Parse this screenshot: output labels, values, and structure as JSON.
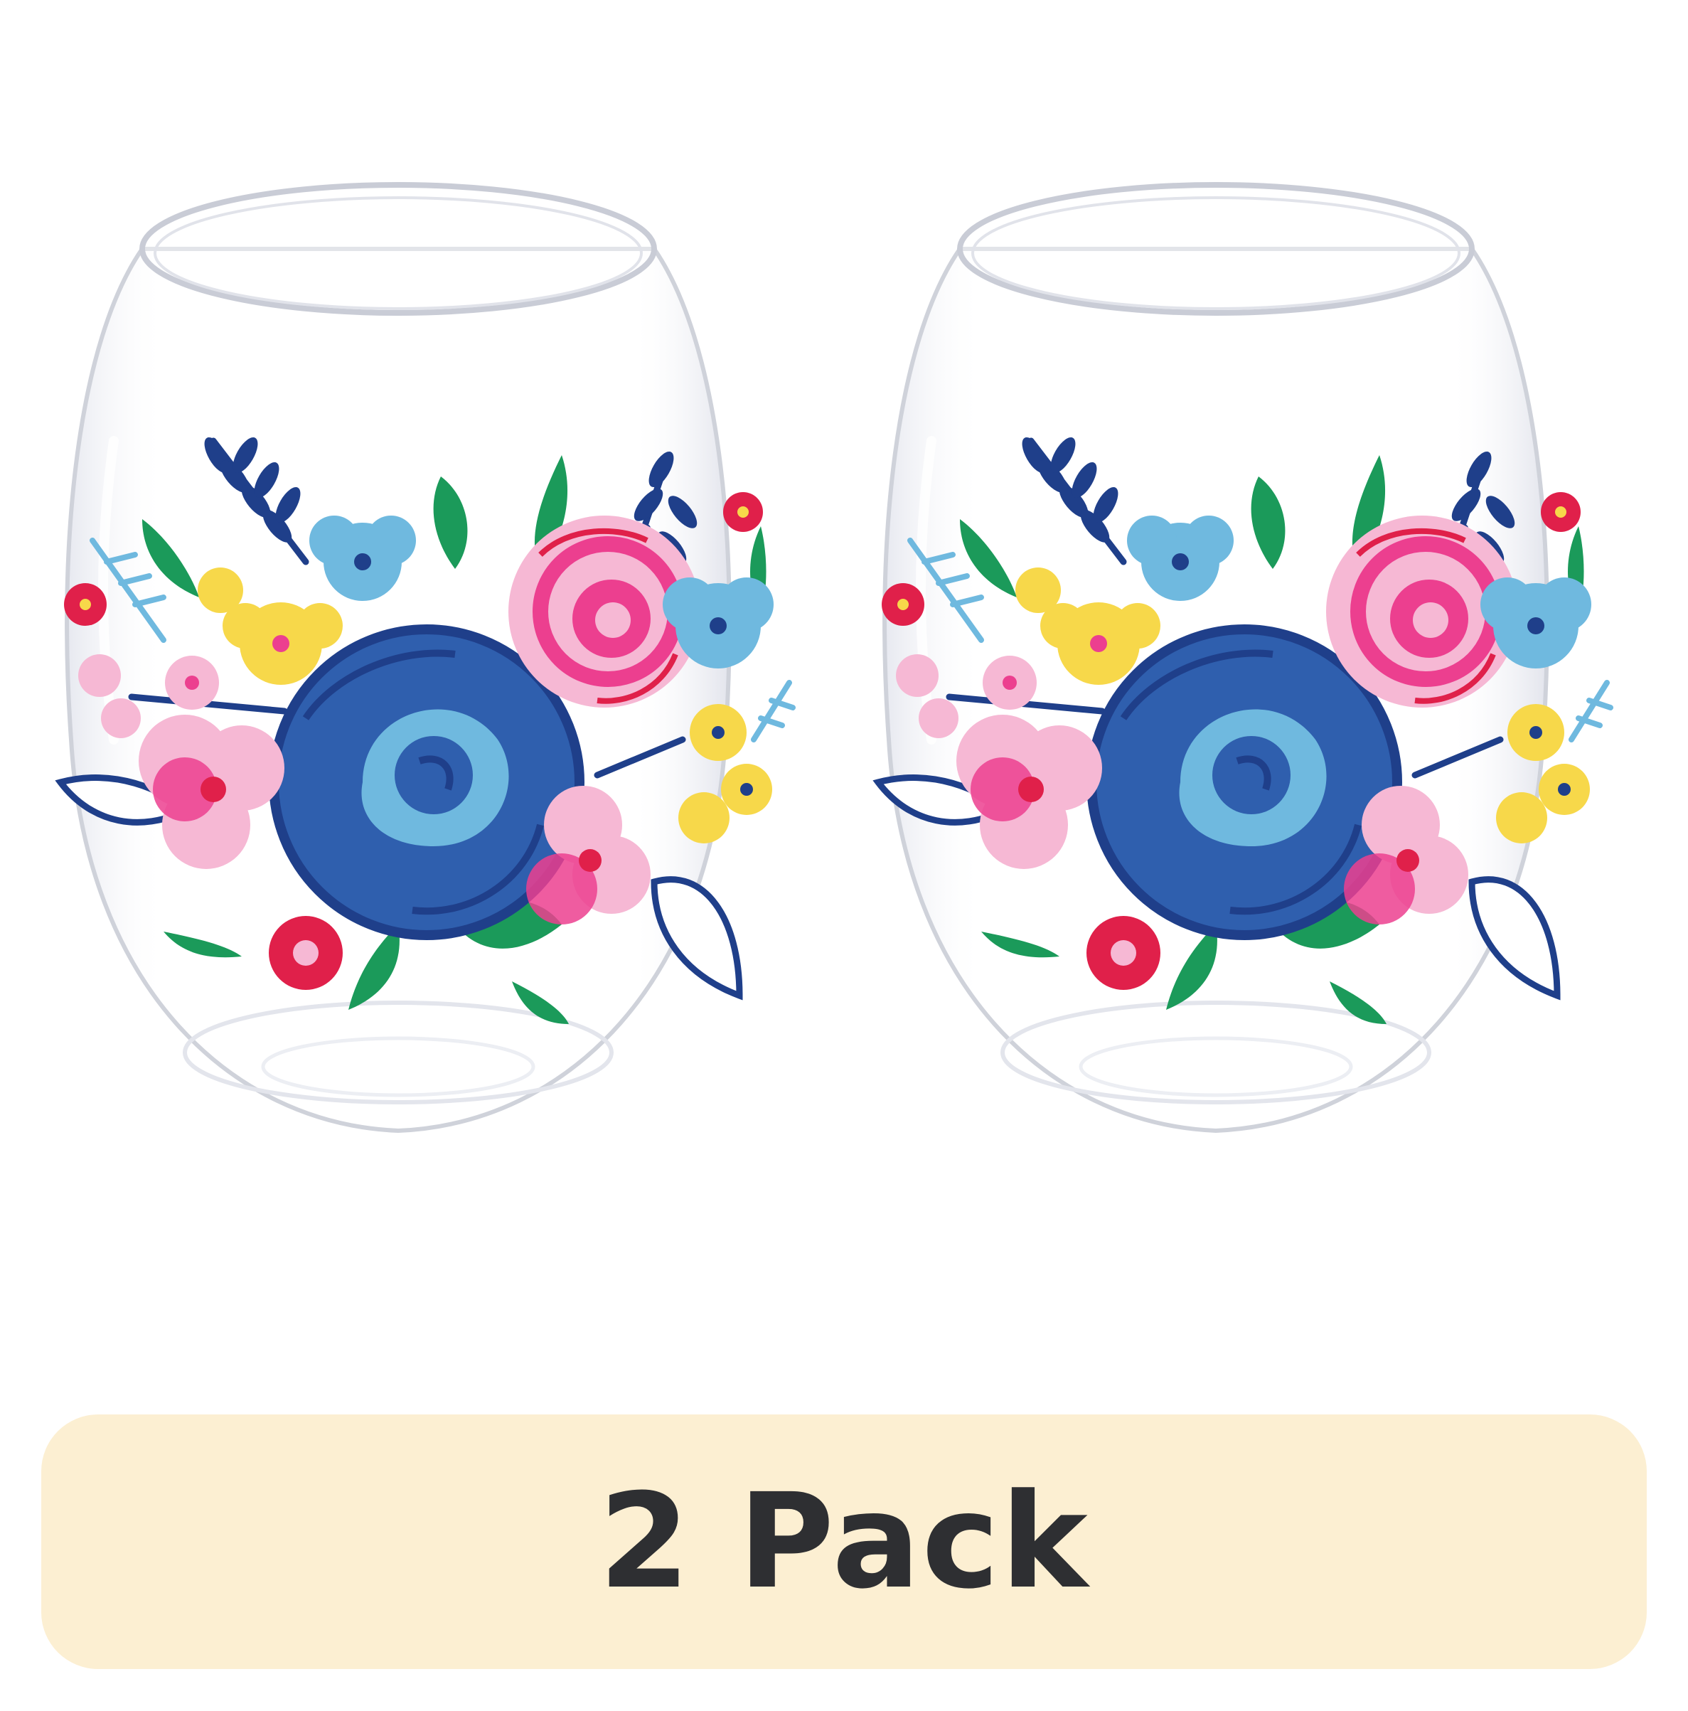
{
  "image": {
    "subject": "two-stemless-floral-glasses",
    "colors": {
      "navy": "#1f3f8a",
      "royal_blue": "#2f5fae",
      "sky_blue": "#6fb9df",
      "hot_pink": "#ec3f8f",
      "light_pink": "#f6b8d4",
      "red": "#e0204a",
      "yellow": "#f7d84a",
      "green": "#1b9a5a",
      "glass_edge": "#c9ccd6"
    }
  },
  "banner": {
    "label": "2 Pack",
    "background": "#fcefd2",
    "text_color": "#2e2f32"
  }
}
